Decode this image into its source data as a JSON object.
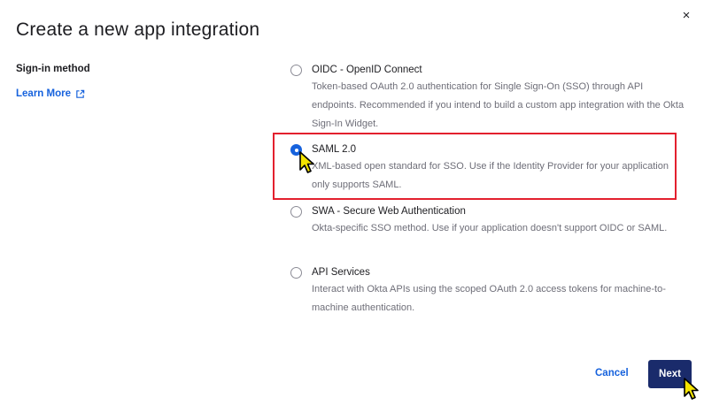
{
  "dialog": {
    "title": "Create a new app integration",
    "close_glyph": "×"
  },
  "signin": {
    "label": "Sign-in method",
    "learn_more": "Learn More",
    "learn_more_icon": "external-link-icon"
  },
  "options": [
    {
      "label": "OIDC - OpenID Connect",
      "desc": "Token-based OAuth 2.0 authentication for Single Sign-On (SSO) through API endpoints. Recommended if you intend to build a custom app integration with the Okta Sign-In Widget.",
      "selected": false
    },
    {
      "label": "SAML 2.0",
      "desc": "XML-based open standard for SSO. Use if the Identity Provider for your application only supports SAML.",
      "selected": true
    },
    {
      "label": "SWA - Secure Web Authentication",
      "desc": "Okta-specific SSO method. Use if your application doesn't support OIDC or SAML.",
      "selected": false
    },
    {
      "label": "API Services",
      "desc": "Interact with Okta APIs using the scoped OAuth 2.0 access tokens for machine-to-machine authentication.",
      "selected": false
    }
  ],
  "footer": {
    "cancel": "Cancel",
    "next": "Next"
  },
  "colors": {
    "accent": "#1662dd",
    "primary_button": "#1a2b6b",
    "highlight": "#e3202e",
    "cursor_fill": "#f5e400"
  }
}
